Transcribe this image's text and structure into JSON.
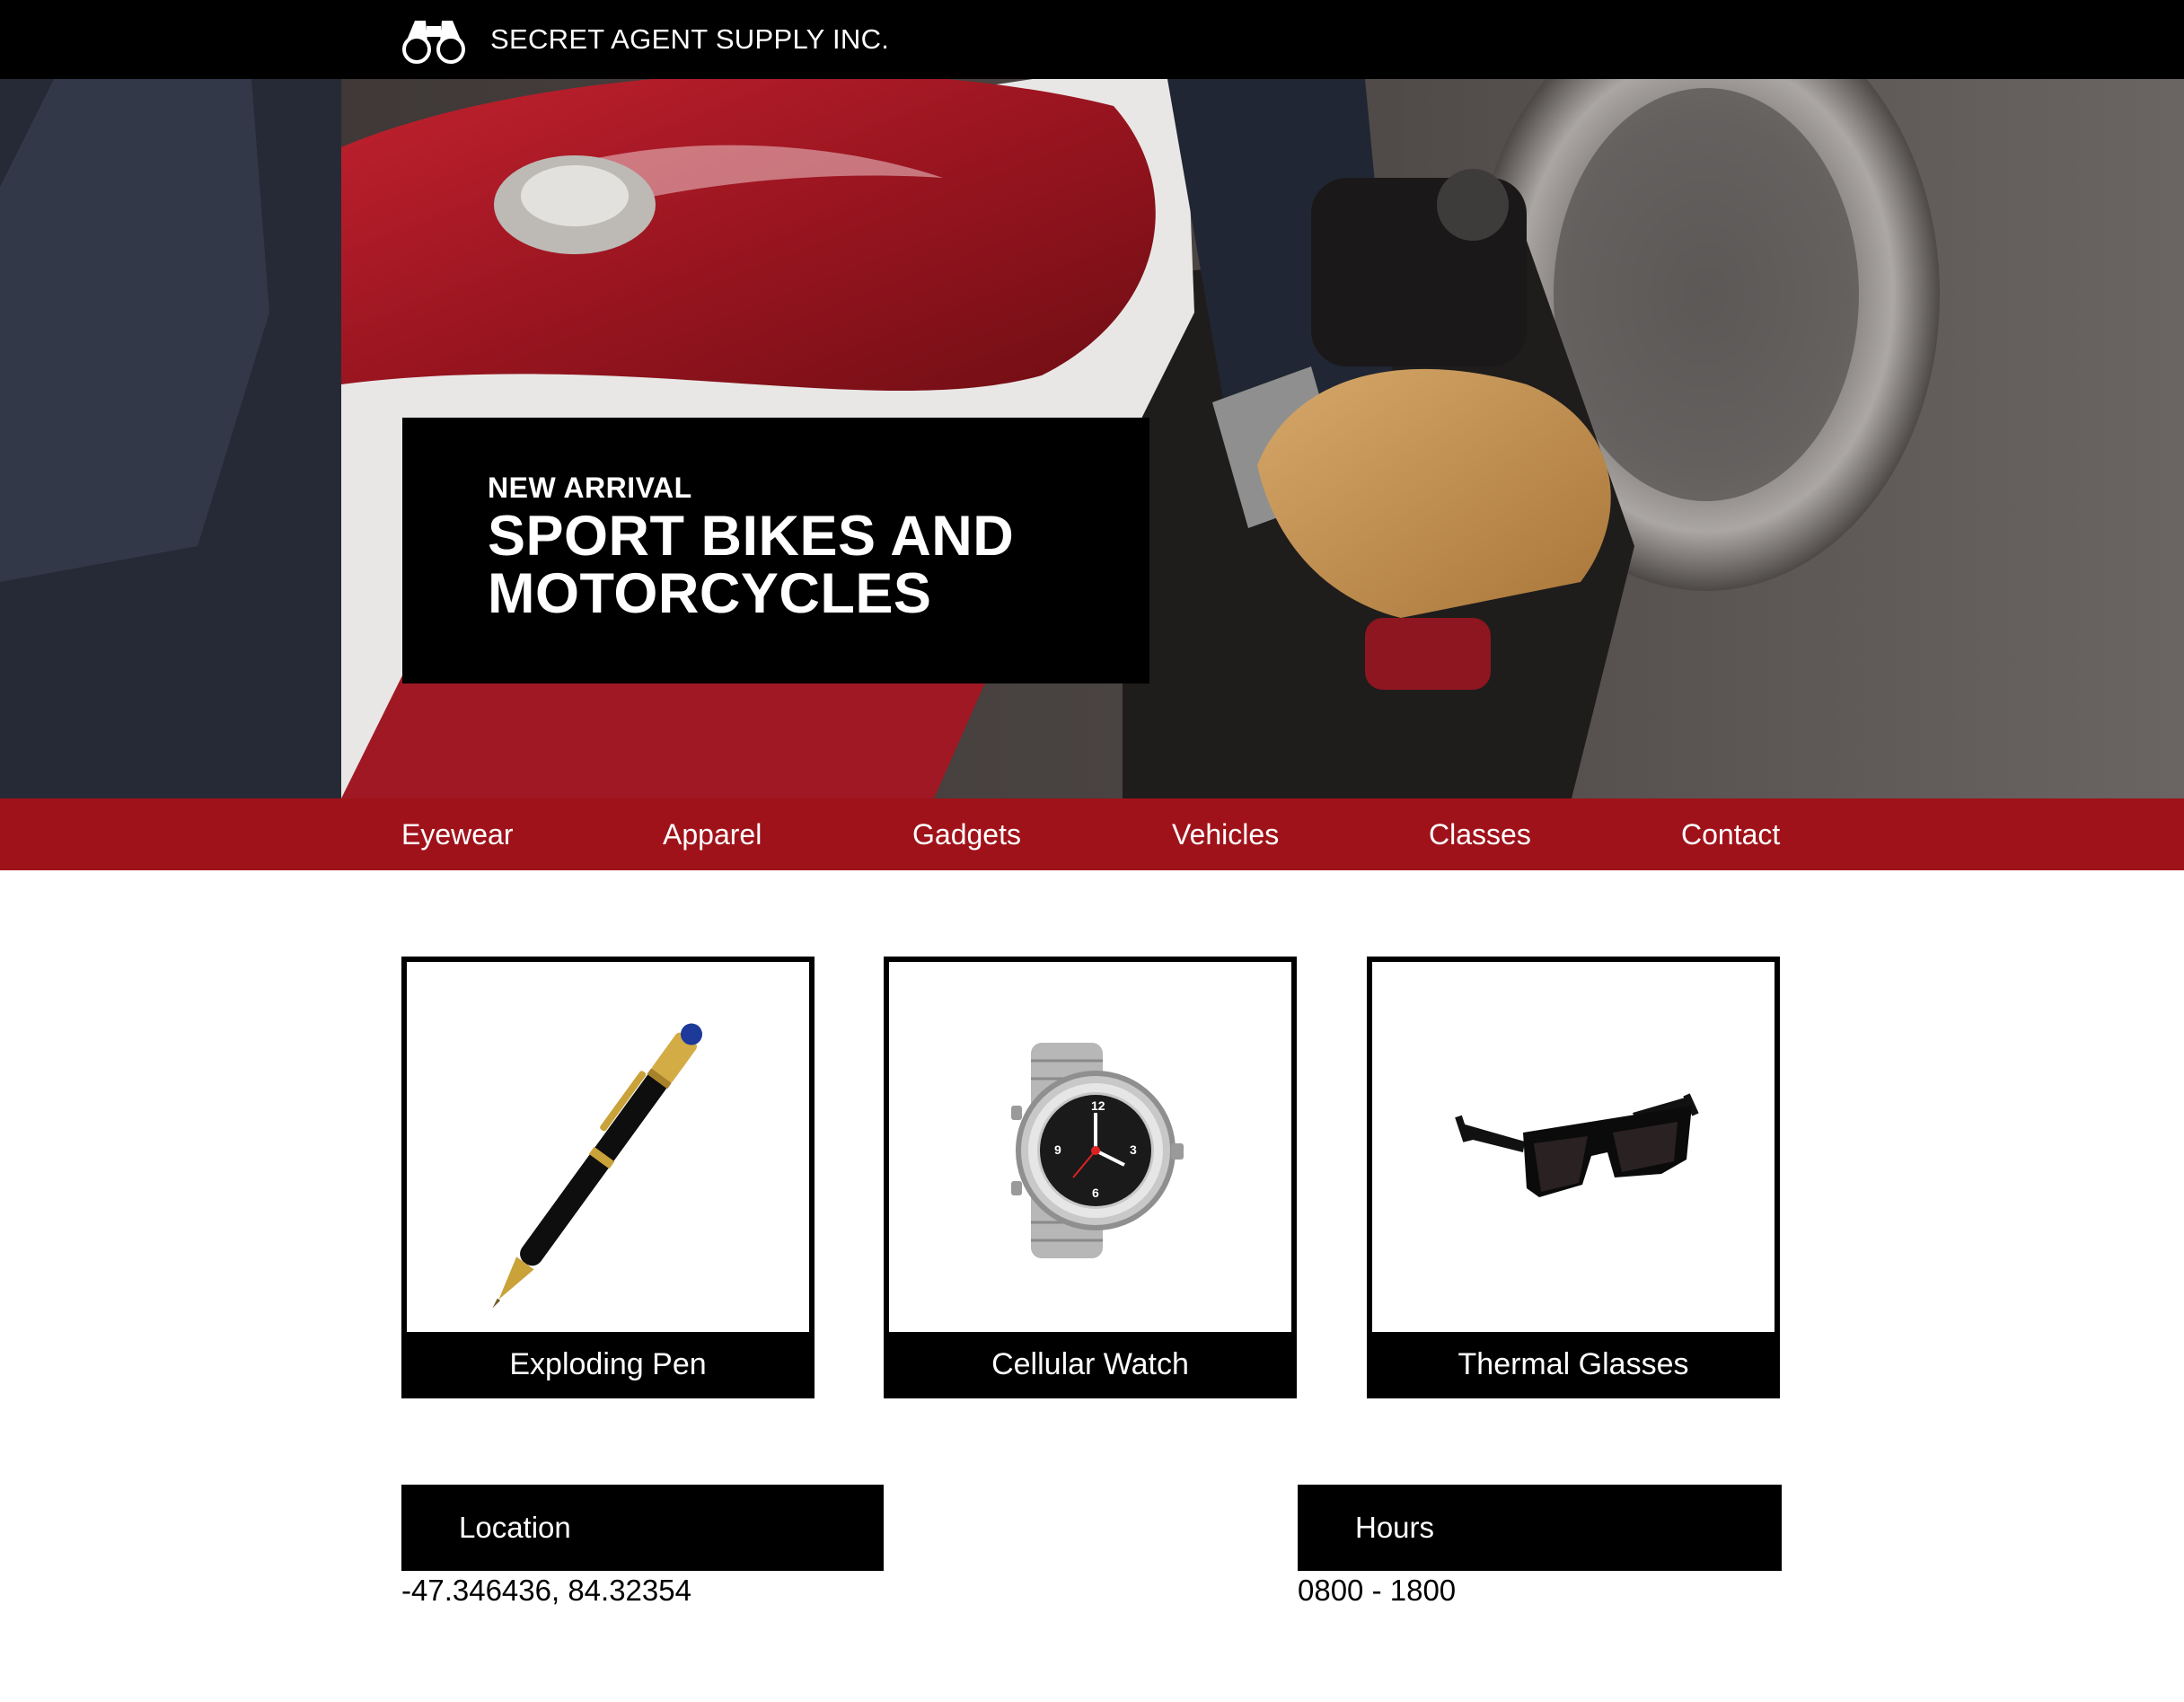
{
  "header": {
    "logo_icon": "binoculars-icon",
    "brand_name": "SECRET AGENT SUPPLY INC."
  },
  "hero": {
    "image": "motorcycle-rider-photo",
    "kicker": "NEW ARRIVAL",
    "title": "SPORT BIKES AND MOTORCYCLES"
  },
  "nav": {
    "background": "#a0121a",
    "items": [
      {
        "label": "Eyewear"
      },
      {
        "label": "Apparel"
      },
      {
        "label": "Gadgets"
      },
      {
        "label": "Vehicles"
      },
      {
        "label": "Classes"
      },
      {
        "label": "Contact"
      }
    ]
  },
  "products": [
    {
      "label": "Exploding Pen",
      "image": "pen-image"
    },
    {
      "label": "Cellular Watch",
      "image": "watch-image"
    },
    {
      "label": "Thermal Glasses",
      "image": "sunglasses-image"
    }
  ],
  "info": {
    "location": {
      "heading": "Location",
      "value": "-47.346436, 84.32354"
    },
    "hours": {
      "heading": "Hours",
      "value": "0800 - 1800"
    }
  }
}
